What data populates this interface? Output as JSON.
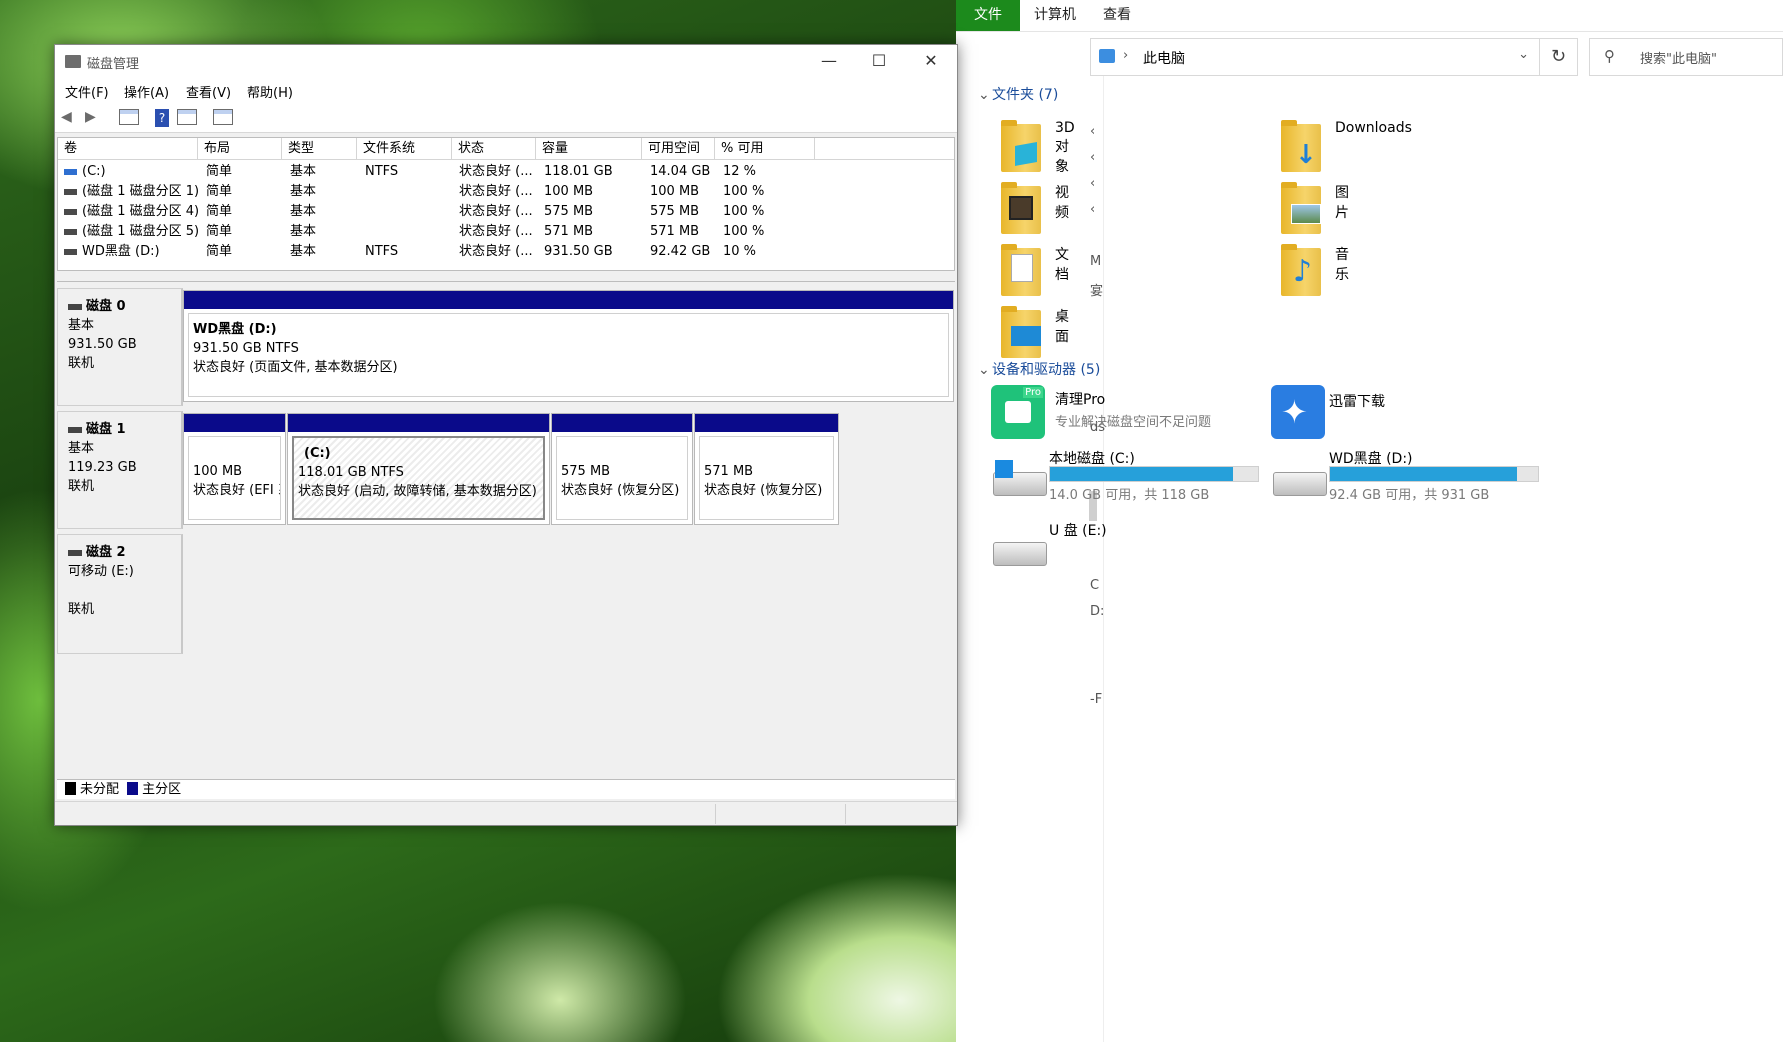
{
  "explorer": {
    "ribbon_tabs": [
      "文件",
      "计算机",
      "查看"
    ],
    "address": "此电脑",
    "search_placeholder": "搜索\"此电脑\"",
    "nav_fragments": [
      "‹",
      "‹",
      "‹",
      "‹",
      "M",
      "宴",
      "ds",
      "C",
      "D:",
      "-F"
    ],
    "folders_header": "文件夹 (7)",
    "folders": [
      "3D 对象",
      "Downloads",
      "视频",
      "图片",
      "文档",
      "音乐",
      "桌面"
    ],
    "devices_header": "设备和驱动器 (5)",
    "apps": [
      {
        "name": "清理Pro",
        "desc": "专业解决磁盘空间不足问题",
        "badge": "Pro"
      },
      {
        "name": "迅雷下载",
        "desc": ""
      }
    ],
    "drives": [
      {
        "name": "本地磁盘 (C:)",
        "detail": "14.0 GB 可用，共 118 GB",
        "used_fraction": 0.88
      },
      {
        "name": "WD黑盘 (D:)",
        "detail": "92.4 GB 可用，共 931 GB",
        "used_fraction": 0.9
      },
      {
        "name": "U 盘 (E:)"
      }
    ]
  },
  "dm": {
    "title": "磁盘管理",
    "menu": [
      "文件(F)",
      "操作(A)",
      "查看(V)",
      "帮助(H)"
    ],
    "toolbar_help": "?",
    "columns": [
      "卷",
      "布局",
      "类型",
      "文件系统",
      "状态",
      "容量",
      "可用空间",
      "% 可用"
    ],
    "volumes": [
      [
        "(C:)",
        "简单",
        "基本",
        "NTFS",
        "状态良好 (...",
        "118.01 GB",
        "14.04 GB",
        "12 %"
      ],
      [
        "(磁盘 1 磁盘分区 1)",
        "简单",
        "基本",
        "",
        "状态良好 (...",
        "100 MB",
        "100 MB",
        "100 %"
      ],
      [
        "(磁盘 1 磁盘分区 4)",
        "简单",
        "基本",
        "",
        "状态良好 (...",
        "575 MB",
        "575 MB",
        "100 %"
      ],
      [
        "(磁盘 1 磁盘分区 5)",
        "简单",
        "基本",
        "",
        "状态良好 (...",
        "571 MB",
        "571 MB",
        "100 %"
      ],
      [
        "WD黑盘 (D:)",
        "简单",
        "基本",
        "NTFS",
        "状态良好 (...",
        "931.50 GB",
        "92.42 GB",
        "10 %"
      ]
    ],
    "disks": [
      {
        "name": "磁盘 0",
        "type": "基本",
        "size": "931.50 GB",
        "state": "联机"
      },
      {
        "name": "磁盘 1",
        "type": "基本",
        "size": "119.23 GB",
        "state": "联机"
      },
      {
        "name": "磁盘 2",
        "type": "可移动 (E:)",
        "size": "",
        "state": "联机"
      }
    ],
    "partitions": [
      {
        "title": "WD黑盘  (D:)",
        "line1": "931.50 GB NTFS",
        "line2": "状态良好 (页面文件, 基本数据分区)"
      },
      {
        "title": "",
        "line1": "100 MB",
        "line2": "状态良好 (EFI 系"
      },
      {
        "title": "(C:)",
        "line1": "118.01 GB NTFS",
        "line2": "状态良好 (启动, 故障转储, 基本数据分区)"
      },
      {
        "title": "",
        "line1": "575 MB",
        "line2": "状态良好 (恢复分区)"
      },
      {
        "title": "",
        "line1": "571 MB",
        "line2": "状态良好 (恢复分区)"
      }
    ],
    "legend": [
      "未分配",
      "主分区"
    ],
    "colors": {
      "unallocated": "#000000",
      "primary": "#0a0a8a"
    }
  }
}
